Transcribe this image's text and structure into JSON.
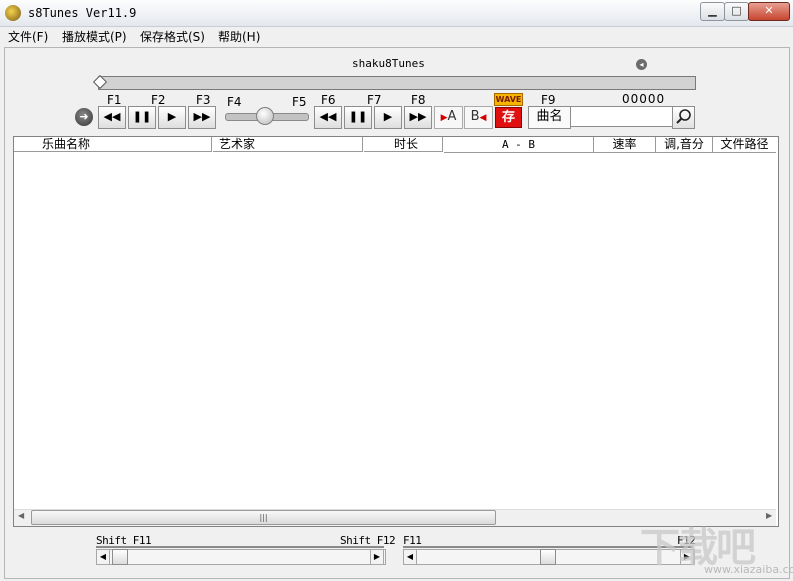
{
  "window": {
    "title": "s8Tunes Ver11.9",
    "min_glyph": "▁",
    "max_glyph": "□",
    "close_glyph": "✕"
  },
  "menu": [
    "文件(F)",
    "播放模式(P)",
    "保存格式(S)",
    "帮助(H)"
  ],
  "player": {
    "track_title": "shaku8Tunes",
    "counter": "00000",
    "fkeys": [
      "F1",
      "F2",
      "F3",
      "F4",
      "F5",
      "F6",
      "F7",
      "F8",
      "F9"
    ],
    "wave_badge": "WAVE",
    "a_label": "A",
    "b_label": "B",
    "save_label": "存",
    "name_label": "曲名",
    "search_value": ""
  },
  "columns": [
    "乐曲名称",
    "艺术家",
    "时长",
    "A - B",
    "速率",
    "调,音分",
    "文件路径"
  ],
  "rows": [],
  "bottom": {
    "left_label_start": "Shift F11",
    "left_label_end": "Shift F12",
    "right_label_start": "F11",
    "right_label_end": "F12"
  },
  "watermark": {
    "text": "下载吧",
    "url": "www.xiazaiba.com"
  }
}
